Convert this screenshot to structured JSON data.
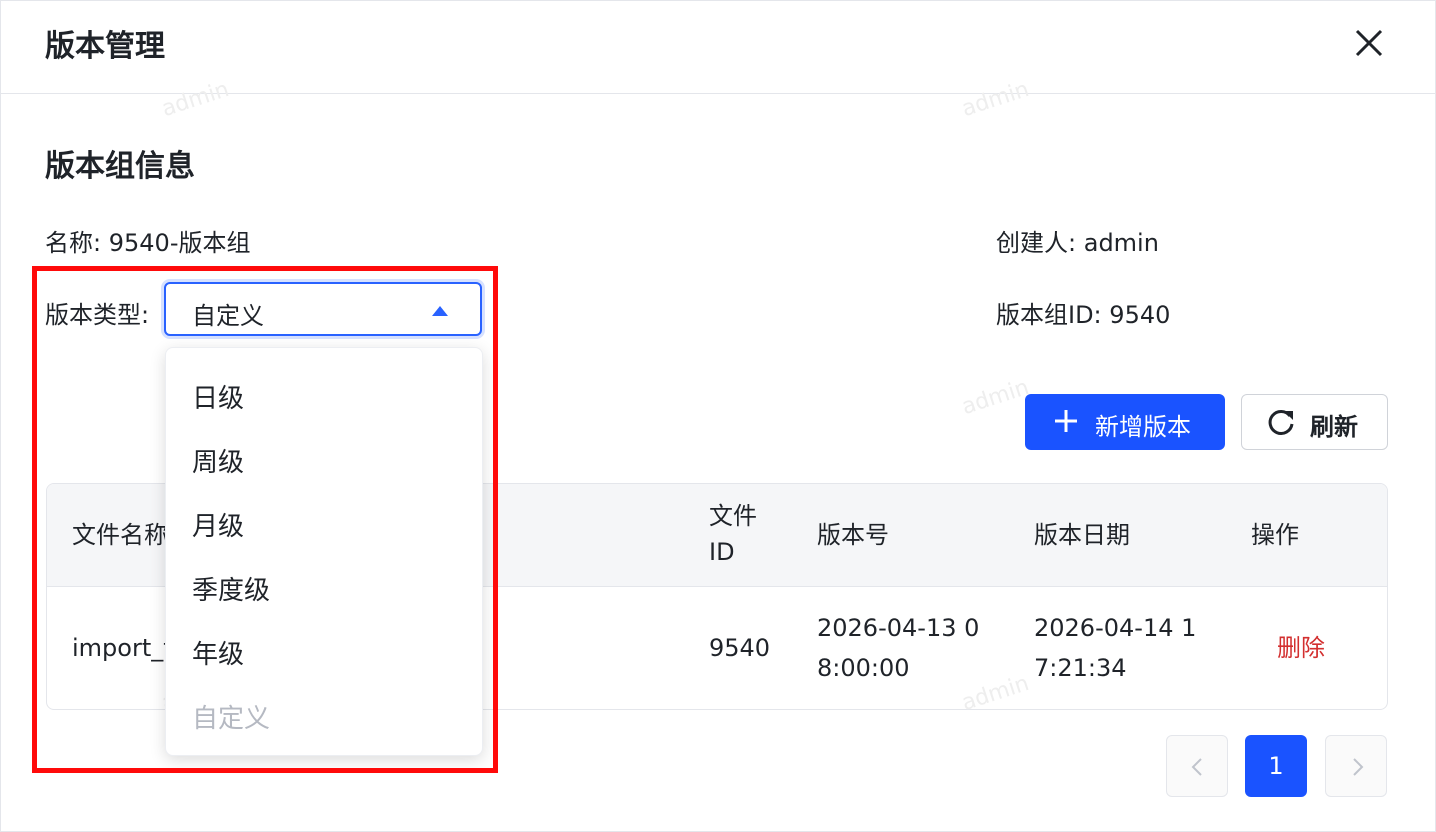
{
  "dialog": {
    "title": "版本管理"
  },
  "section": {
    "title": "版本组信息"
  },
  "info": {
    "name_label": "名称:",
    "name_value": "9540-版本组",
    "creator_label": "创建人:",
    "creator_value": "admin",
    "type_label": "版本类型:",
    "type_value": "自定义",
    "group_id_label": "版本组ID:",
    "group_id_value": "9540"
  },
  "dropdown": {
    "options": [
      {
        "label": "日级",
        "disabled": false
      },
      {
        "label": "周级",
        "disabled": false
      },
      {
        "label": "月级",
        "disabled": false
      },
      {
        "label": "季度级",
        "disabled": false
      },
      {
        "label": "年级",
        "disabled": false
      },
      {
        "label": "自定义",
        "disabled": true
      }
    ]
  },
  "toolbar": {
    "add_label": "新增版本",
    "refresh_label": "刷新",
    "add_color": "#1a53ff"
  },
  "table": {
    "headers": {
      "file_name": "文件名称",
      "file_id_line1": "文件",
      "file_id_line2": "ID",
      "version_no": "版本号",
      "version_date": "版本日期",
      "actions": "操作"
    },
    "rows": [
      {
        "file_name": "import_t",
        "file_id": "9540",
        "version_no_line1": "2026-04-13 0",
        "version_no_line2": "8:00:00",
        "version_date_line1": "2026-04-14 1",
        "version_date_line2": "7:21:34",
        "action": "删除"
      }
    ]
  },
  "pagination": {
    "current": "1"
  },
  "watermark": "admin",
  "highlight_color": "#ff0a0a"
}
